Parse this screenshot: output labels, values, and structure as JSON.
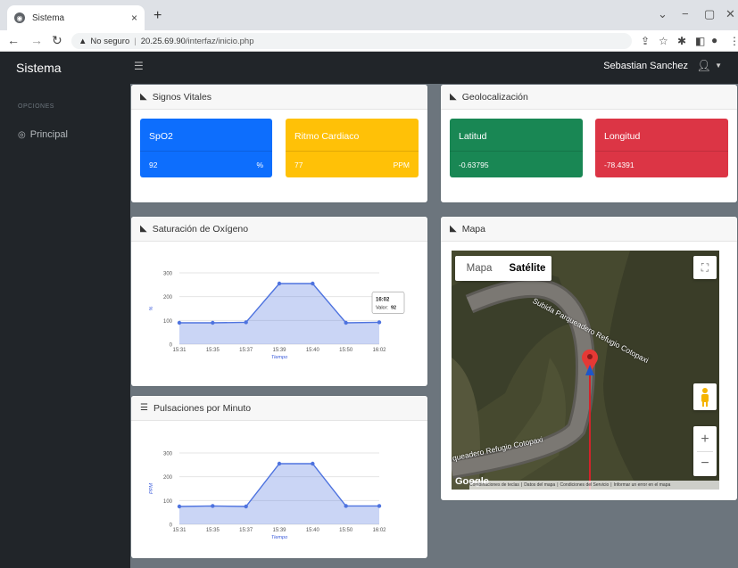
{
  "browser": {
    "tab_title": "Sistema",
    "tab_close": "×",
    "new_tab": "+",
    "security": "No seguro",
    "host": "20.25.69.90",
    "path": "/interfaz/inicio.php",
    "min": "−",
    "restore": "▢",
    "close": "✕",
    "caret": "⌄"
  },
  "app": {
    "brand": "Sistema",
    "user_name": "Sebastian Sanchez",
    "sidebar_heading": "OPCIONES",
    "sidebar_link": "Principal"
  },
  "signos": {
    "title": "Signos Vitales",
    "spo2": {
      "label": "SpO2",
      "value": "92",
      "unit": "%",
      "color": "#0d6efd"
    },
    "ritmo": {
      "label": "Ritmo Cardiaco",
      "value": "77",
      "unit": "PPM",
      "color": "#ffc107"
    }
  },
  "geo": {
    "title": "Geolocalización",
    "lat": {
      "label": "Latitud",
      "value": "-0.63795",
      "color": "#198754"
    },
    "lon": {
      "label": "Longitud",
      "value": "-78.4391",
      "color": "#dc3545"
    }
  },
  "mapa": {
    "title": "Mapa",
    "type_map": "Mapa",
    "type_sat": "Satélite",
    "road_label_1": "Subida Parqueadero Refugio Cotopaxi",
    "road_label_2": "queadero Refugio Cotopaxi",
    "google": "Google",
    "footer": [
      "Combinaciones de teclas",
      "Datos del mapa",
      "Condiciones del Servicio",
      "Informar un error en el mapa"
    ],
    "zoom_in": "+",
    "zoom_out": "−"
  },
  "chart_data": [
    {
      "type": "area",
      "title": "Saturación de Oxígeno",
      "categories": [
        "15:31",
        "15:35",
        "15:37",
        "15:39",
        "15:40",
        "15:50",
        "16:02"
      ],
      "values": [
        90,
        90,
        92,
        255,
        255,
        90,
        92
      ],
      "ylim": [
        0,
        300
      ],
      "yticks": [
        "0",
        "100",
        "200",
        "300"
      ],
      "xlabel": "Tiempo",
      "ylabel": "%",
      "tooltip": {
        "time": "16:02",
        "label": "Valor:",
        "value": "92"
      },
      "color": "#4e73df"
    },
    {
      "type": "area",
      "title": "Pulsaciones por Minuto",
      "categories": [
        "15:31",
        "15:35",
        "15:37",
        "15:39",
        "15:40",
        "15:50",
        "16:02"
      ],
      "values": [
        75,
        77,
        75,
        255,
        255,
        77,
        77
      ],
      "ylim": [
        0,
        300
      ],
      "yticks": [
        "0",
        "100",
        "200",
        "300"
      ],
      "xlabel": "Tiempo",
      "ylabel": "PPM",
      "color": "#4e73df"
    }
  ]
}
